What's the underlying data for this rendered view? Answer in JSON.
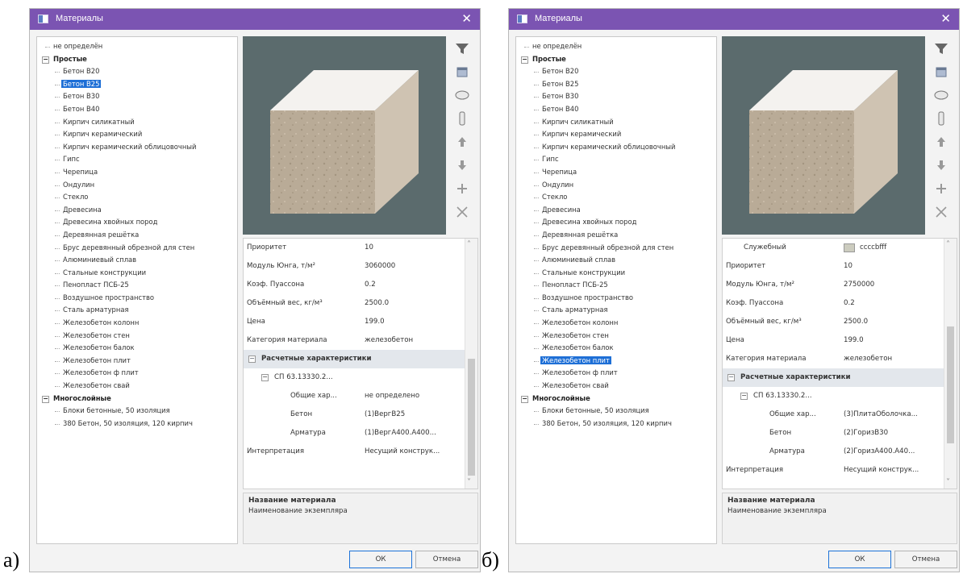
{
  "labels": {
    "a": "a)",
    "b": "б)"
  },
  "dialogs": [
    {
      "title": "Материалы",
      "tree": [
        {
          "label": "не определён",
          "level": 0,
          "type": "item"
        },
        {
          "label": "Простые",
          "level": 0,
          "type": "group"
        },
        {
          "label": "Бетон В20",
          "level": 1,
          "type": "item"
        },
        {
          "label": "Бетон В25",
          "level": 1,
          "type": "item",
          "selected": true
        },
        {
          "label": "Бетон В30",
          "level": 1,
          "type": "item"
        },
        {
          "label": "Бетон В40",
          "level": 1,
          "type": "item"
        },
        {
          "label": "Кирпич силикатный",
          "level": 1,
          "type": "item"
        },
        {
          "label": "Кирпич керамический",
          "level": 1,
          "type": "item"
        },
        {
          "label": "Кирпич керамический облицовочный",
          "level": 1,
          "type": "item"
        },
        {
          "label": "Гипс",
          "level": 1,
          "type": "item"
        },
        {
          "label": "Черепица",
          "level": 1,
          "type": "item"
        },
        {
          "label": "Ондулин",
          "level": 1,
          "type": "item"
        },
        {
          "label": "Стекло",
          "level": 1,
          "type": "item"
        },
        {
          "label": "Древесина",
          "level": 1,
          "type": "item"
        },
        {
          "label": "Древесина хвойных пород",
          "level": 1,
          "type": "item"
        },
        {
          "label": "Деревянная решётка",
          "level": 1,
          "type": "item"
        },
        {
          "label": "Брус деревянный обрезной для стен",
          "level": 1,
          "type": "item"
        },
        {
          "label": "Алюминиевый сплав",
          "level": 1,
          "type": "item"
        },
        {
          "label": "Стальные конструкции",
          "level": 1,
          "type": "item"
        },
        {
          "label": "Пенопласт ПСБ-25",
          "level": 1,
          "type": "item"
        },
        {
          "label": "Воздушное пространство",
          "level": 1,
          "type": "item"
        },
        {
          "label": "Сталь арматурная",
          "level": 1,
          "type": "item"
        },
        {
          "label": "Железобетон колонн",
          "level": 1,
          "type": "item"
        },
        {
          "label": "Железобетон стен",
          "level": 1,
          "type": "item"
        },
        {
          "label": "Железобетон балок",
          "level": 1,
          "type": "item"
        },
        {
          "label": "Железобетон плит",
          "level": 1,
          "type": "item"
        },
        {
          "label": "Железобетон ф плит",
          "level": 1,
          "type": "item"
        },
        {
          "label": "Железобетон свай",
          "level": 1,
          "type": "item"
        },
        {
          "label": "Многослойные",
          "level": 0,
          "type": "group"
        },
        {
          "label": "Блоки бетонные, 50 изоляция",
          "level": 1,
          "type": "item"
        },
        {
          "label": "380 Бетон, 50 изоляция, 120 кирпич",
          "level": 1,
          "type": "item"
        }
      ],
      "properties": [
        {
          "k": "Приоритет",
          "v": "10",
          "type": "row"
        },
        {
          "k": "Модуль Юнга, т/м²",
          "v": "3060000",
          "type": "row"
        },
        {
          "k": "Коэф. Пуассона",
          "v": "0.2",
          "type": "row"
        },
        {
          "k": "Объёмный вес, кг/м³",
          "v": "2500.0",
          "type": "row"
        },
        {
          "k": "Цена",
          "v": "199.0",
          "type": "row"
        },
        {
          "k": "Категория материала",
          "v": "железобетон",
          "type": "row"
        },
        {
          "k": "Расчетные характеристики",
          "v": "",
          "type": "section"
        },
        {
          "k": "СП 63.13330.2...",
          "v": "",
          "type": "sub"
        },
        {
          "k": "Общие хар...",
          "v": "не определено",
          "type": "leaf"
        },
        {
          "k": "Бетон",
          "v": "(1)ВергВ25",
          "type": "leaf"
        },
        {
          "k": "Арматура",
          "v": "(1)ВергА400.А400...",
          "type": "leaf"
        },
        {
          "k": "Интерпретация",
          "v": "Несущий конструк...",
          "type": "row"
        }
      ],
      "scroll_thumb": {
        "from": 0.48,
        "to": 0.95
      },
      "description": {
        "title": "Название материала",
        "subtitle": "Наименование экземпляра"
      },
      "buttons": {
        "ok": "ОК",
        "cancel": "Отмена"
      }
    },
    {
      "title": "Материалы",
      "tree": [
        {
          "label": "не определён",
          "level": 0,
          "type": "item"
        },
        {
          "label": "Простые",
          "level": 0,
          "type": "group"
        },
        {
          "label": "Бетон В20",
          "level": 1,
          "type": "item"
        },
        {
          "label": "Бетон В25",
          "level": 1,
          "type": "item"
        },
        {
          "label": "Бетон В30",
          "level": 1,
          "type": "item"
        },
        {
          "label": "Бетон В40",
          "level": 1,
          "type": "item"
        },
        {
          "label": "Кирпич силикатный",
          "level": 1,
          "type": "item"
        },
        {
          "label": "Кирпич керамический",
          "level": 1,
          "type": "item"
        },
        {
          "label": "Кирпич керамический облицовочный",
          "level": 1,
          "type": "item"
        },
        {
          "label": "Гипс",
          "level": 1,
          "type": "item"
        },
        {
          "label": "Черепица",
          "level": 1,
          "type": "item"
        },
        {
          "label": "Ондулин",
          "level": 1,
          "type": "item"
        },
        {
          "label": "Стекло",
          "level": 1,
          "type": "item"
        },
        {
          "label": "Древесина",
          "level": 1,
          "type": "item"
        },
        {
          "label": "Древесина хвойных пород",
          "level": 1,
          "type": "item"
        },
        {
          "label": "Деревянная решётка",
          "level": 1,
          "type": "item"
        },
        {
          "label": "Брус деревянный обрезной для стен",
          "level": 1,
          "type": "item"
        },
        {
          "label": "Алюминиевый сплав",
          "level": 1,
          "type": "item"
        },
        {
          "label": "Стальные конструкции",
          "level": 1,
          "type": "item"
        },
        {
          "label": "Пенопласт ПСБ-25",
          "level": 1,
          "type": "item"
        },
        {
          "label": "Воздушное пространство",
          "level": 1,
          "type": "item"
        },
        {
          "label": "Сталь арматурная",
          "level": 1,
          "type": "item"
        },
        {
          "label": "Железобетон колонн",
          "level": 1,
          "type": "item"
        },
        {
          "label": "Железобетон стен",
          "level": 1,
          "type": "item"
        },
        {
          "label": "Железобетон балок",
          "level": 1,
          "type": "item"
        },
        {
          "label": "Железобетон плит",
          "level": 1,
          "type": "item",
          "selected": true
        },
        {
          "label": "Железобетон ф плит",
          "level": 1,
          "type": "item"
        },
        {
          "label": "Железобетон свай",
          "level": 1,
          "type": "item"
        },
        {
          "label": "Многослойные",
          "level": 0,
          "type": "group"
        },
        {
          "label": "Блоки бетонные, 50 изоляция",
          "level": 1,
          "type": "item"
        },
        {
          "label": "380 Бетон, 50 изоляция, 120 кирпич",
          "level": 1,
          "type": "item"
        }
      ],
      "properties": [
        {
          "k": "Служебный",
          "v": "ccccbfff",
          "type": "color",
          "swatch": "#ccccbf"
        },
        {
          "k": "Приоритет",
          "v": "10",
          "type": "row"
        },
        {
          "k": "Модуль Юнга, т/м²",
          "v": "2750000",
          "type": "row"
        },
        {
          "k": "Коэф. Пуассона",
          "v": "0.2",
          "type": "row"
        },
        {
          "k": "Объёмный вес, кг/м³",
          "v": "2500.0",
          "type": "row"
        },
        {
          "k": "Цена",
          "v": "199.0",
          "type": "row"
        },
        {
          "k": "Категория материала",
          "v": "железобетон",
          "type": "row"
        },
        {
          "k": "Расчетные характеристики",
          "v": "",
          "type": "section"
        },
        {
          "k": "СП 63.13330.2...",
          "v": "",
          "type": "sub"
        },
        {
          "k": "Общие хар...",
          "v": "(3)ПлитаОболочка...",
          "type": "leaf"
        },
        {
          "k": "Бетон",
          "v": "(2)ГоризВ30",
          "type": "leaf"
        },
        {
          "k": "Арматура",
          "v": "(2)ГоризА400.А40...",
          "type": "leaf"
        },
        {
          "k": "Интерпретация",
          "v": "Несущий конструк...",
          "type": "row"
        }
      ],
      "scroll_thumb": {
        "from": 0.35,
        "to": 0.82
      },
      "description": {
        "title": "Название материала",
        "subtitle": "Наименование экземпляра"
      },
      "buttons": {
        "ok": "ОК",
        "cancel": "Отмена"
      }
    }
  ],
  "colors": {
    "titlebar": "#7b54b2",
    "selection": "#1e6fd6",
    "preview_bg": "#5b6b6d",
    "section_bg": "#e3e7ec"
  }
}
